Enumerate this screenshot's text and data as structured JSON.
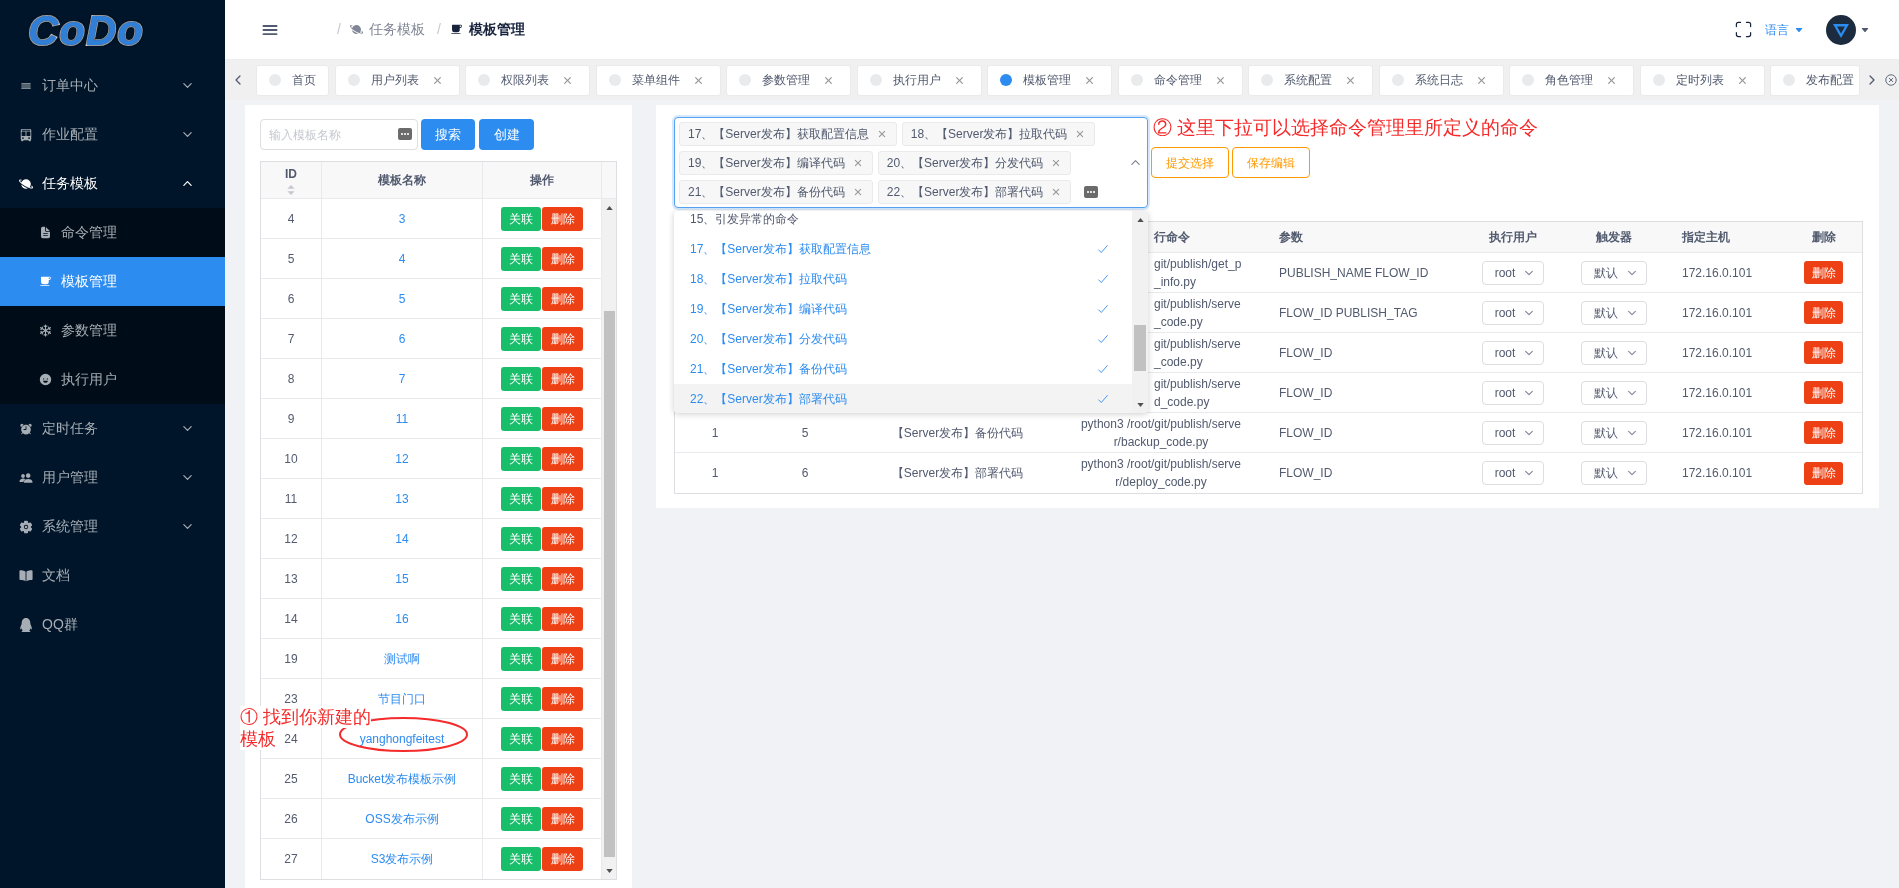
{
  "sidebar": {
    "logo": "CoDo",
    "items": [
      {
        "kind": "group",
        "label": "订单中心",
        "expanded": false
      },
      {
        "kind": "group",
        "label": "作业配置",
        "expanded": false
      },
      {
        "kind": "group",
        "label": "任务模板",
        "expanded": true,
        "children": [
          {
            "label": "命令管理",
            "selected": false
          },
          {
            "label": "模板管理",
            "selected": true
          },
          {
            "label": "参数管理",
            "selected": false
          },
          {
            "label": "执行用户",
            "selected": false
          }
        ]
      },
      {
        "kind": "group",
        "label": "定时任务",
        "expanded": false
      },
      {
        "kind": "group",
        "label": "用户管理",
        "expanded": false
      },
      {
        "kind": "group",
        "label": "系统管理",
        "expanded": false
      },
      {
        "kind": "link",
        "label": "文档",
        "selected": false
      },
      {
        "kind": "link",
        "label": "QQ群",
        "selected": false
      }
    ]
  },
  "header": {
    "breadcrumb": [
      {
        "kind": "separator",
        "text": "/"
      },
      {
        "kind": "crumb",
        "label": "任务模板",
        "current": false
      },
      {
        "kind": "separator",
        "text": "/"
      },
      {
        "kind": "crumb",
        "label": "模板管理",
        "current": true
      }
    ],
    "language": "语言"
  },
  "tabs": [
    {
      "label": "首页",
      "selected": false,
      "closable": false
    },
    {
      "label": "用户列表",
      "selected": false,
      "closable": true
    },
    {
      "label": "权限列表",
      "selected": false,
      "closable": true
    },
    {
      "label": "菜单组件",
      "selected": false,
      "closable": true
    },
    {
      "label": "参数管理",
      "selected": false,
      "closable": true
    },
    {
      "label": "执行用户",
      "selected": false,
      "closable": true
    },
    {
      "label": "模板管理",
      "selected": true,
      "closable": true
    },
    {
      "label": "命令管理",
      "selected": false,
      "closable": true
    },
    {
      "label": "系统配置",
      "selected": false,
      "closable": true
    },
    {
      "label": "系统日志",
      "selected": false,
      "closable": true
    },
    {
      "label": "角色管理",
      "selected": false,
      "closable": true
    },
    {
      "label": "定时列表",
      "selected": false,
      "closable": true
    },
    {
      "label": "发布配置",
      "selected": false,
      "closable": false
    }
  ],
  "template_panel": {
    "search": {
      "placeholder": "输入模板名称"
    },
    "buttons": [
      "搜索",
      "创建"
    ],
    "note": [
      "① 找到你新建的",
      "模板"
    ],
    "table": {
      "columns": [
        "ID",
        "模板名称",
        "操作"
      ],
      "rows": [
        {
          "id": "4",
          "name": "3",
          "link": "关联",
          "delete": "删除",
          "circled": false
        },
        {
          "id": "5",
          "name": "4",
          "link": "关联",
          "delete": "删除",
          "circled": false
        },
        {
          "id": "6",
          "name": "5",
          "link": "关联",
          "delete": "删除",
          "circled": false
        },
        {
          "id": "7",
          "name": "6",
          "link": "关联",
          "delete": "删除",
          "circled": false
        },
        {
          "id": "8",
          "name": "7",
          "link": "关联",
          "delete": "删除",
          "circled": false
        },
        {
          "id": "9",
          "name": "11",
          "link": "关联",
          "delete": "删除",
          "circled": false
        },
        {
          "id": "10",
          "name": "12",
          "link": "关联",
          "delete": "删除",
          "circled": false
        },
        {
          "id": "11",
          "name": "13",
          "link": "关联",
          "delete": "删除",
          "circled": false
        },
        {
          "id": "12",
          "name": "14",
          "link": "关联",
          "delete": "删除",
          "circled": false
        },
        {
          "id": "13",
          "name": "15",
          "link": "关联",
          "delete": "删除",
          "circled": false
        },
        {
          "id": "14",
          "name": "16",
          "link": "关联",
          "delete": "删除",
          "circled": false
        },
        {
          "id": "19",
          "name": "测试啊",
          "link": "关联",
          "delete": "删除",
          "circled": false
        },
        {
          "id": "23",
          "name": "节目门口",
          "link": "关联",
          "delete": "删除",
          "circled": false
        },
        {
          "id": "24",
          "name": "yanghongfeitest",
          "link": "关联",
          "delete": "删除",
          "circled": true
        },
        {
          "id": "25",
          "name": "Bucket发布模板示例",
          "link": "关联",
          "delete": "删除",
          "circled": false
        },
        {
          "id": "26",
          "name": "OSS发布示例",
          "link": "关联",
          "delete": "删除",
          "circled": false
        },
        {
          "id": "27",
          "name": "S3发布示例",
          "link": "关联",
          "delete": "删除",
          "circled": false
        }
      ]
    }
  },
  "command_panel": {
    "select": {
      "expanded": true,
      "tags": [
        "17、【Server发布】获取配置信息",
        "18、【Server发布】拉取代码",
        "19、【Server发布】编译代码",
        "20、【Server发布】分发代码",
        "21、【Server发布】备份代码",
        "22、【Server发布】部署代码"
      ]
    },
    "buttons": [
      "提交选择",
      "保存编辑"
    ],
    "note": "② 这里下拉可以选择命令管理里所定义的命令",
    "dropdown": [
      {
        "label": "15、引发异常的命令",
        "selected": false,
        "hovered": false
      },
      {
        "label": "17、【Server发布】获取配置信息",
        "selected": true,
        "hovered": false
      },
      {
        "label": "18、【Server发布】拉取代码",
        "selected": true,
        "hovered": false
      },
      {
        "label": "19、【Server发布】编译代码",
        "selected": true,
        "hovered": false
      },
      {
        "label": "20、【Server发布】分发代码",
        "selected": true,
        "hovered": false
      },
      {
        "label": "21、【Server发布】备份代码",
        "selected": true,
        "hovered": false
      },
      {
        "label": "22、【Server发布】部署代码",
        "selected": true,
        "hovered": true
      }
    ],
    "table": {
      "columns": [
        "行命令",
        "参数",
        "执行用户",
        "触发器",
        "指定主机",
        "删除"
      ],
      "rows": [
        {
          "kind": "partial",
          "command": [
            "git/publish/get_p",
            "_info.py"
          ],
          "params": "PUBLISH_NAME FLOW_ID",
          "user": "root",
          "trigger": "默认",
          "host": "172.16.0.101",
          "action": "删除"
        },
        {
          "kind": "partial",
          "command": [
            "git/publish/serve",
            "_code.py"
          ],
          "params": "FLOW_ID PUBLISH_TAG",
          "user": "root",
          "trigger": "默认",
          "host": "172.16.0.101",
          "action": "删除"
        },
        {
          "kind": "partial",
          "command": [
            "git/publish/serve",
            "_code.py"
          ],
          "params": "FLOW_ID",
          "user": "root",
          "trigger": "默认",
          "host": "172.16.0.101",
          "action": "删除"
        },
        {
          "kind": "partial",
          "command": [
            "git/publish/serve",
            "d_code.py"
          ],
          "params": "FLOW_ID",
          "user": "root",
          "trigger": "默认",
          "host": "172.16.0.101",
          "action": "删除"
        },
        {
          "kind": "full",
          "column_1": "1",
          "column_2": "5",
          "column_3": "【Server发布】备份代码",
          "command": [
            "python3 /root/git/publish/serve",
            "r/backup_code.py"
          ],
          "params": "FLOW_ID",
          "user": "root",
          "trigger": "默认",
          "host": "172.16.0.101",
          "action": "删除"
        },
        {
          "kind": "full",
          "column_1": "1",
          "column_2": "6",
          "column_3": "【Server发布】部署代码",
          "command": [
            "python3 /root/git/publish/serve",
            "r/deploy_code.py"
          ],
          "params": "FLOW_ID",
          "user": "root",
          "trigger": "默认",
          "host": "172.16.0.101",
          "action": "删除"
        }
      ]
    }
  }
}
